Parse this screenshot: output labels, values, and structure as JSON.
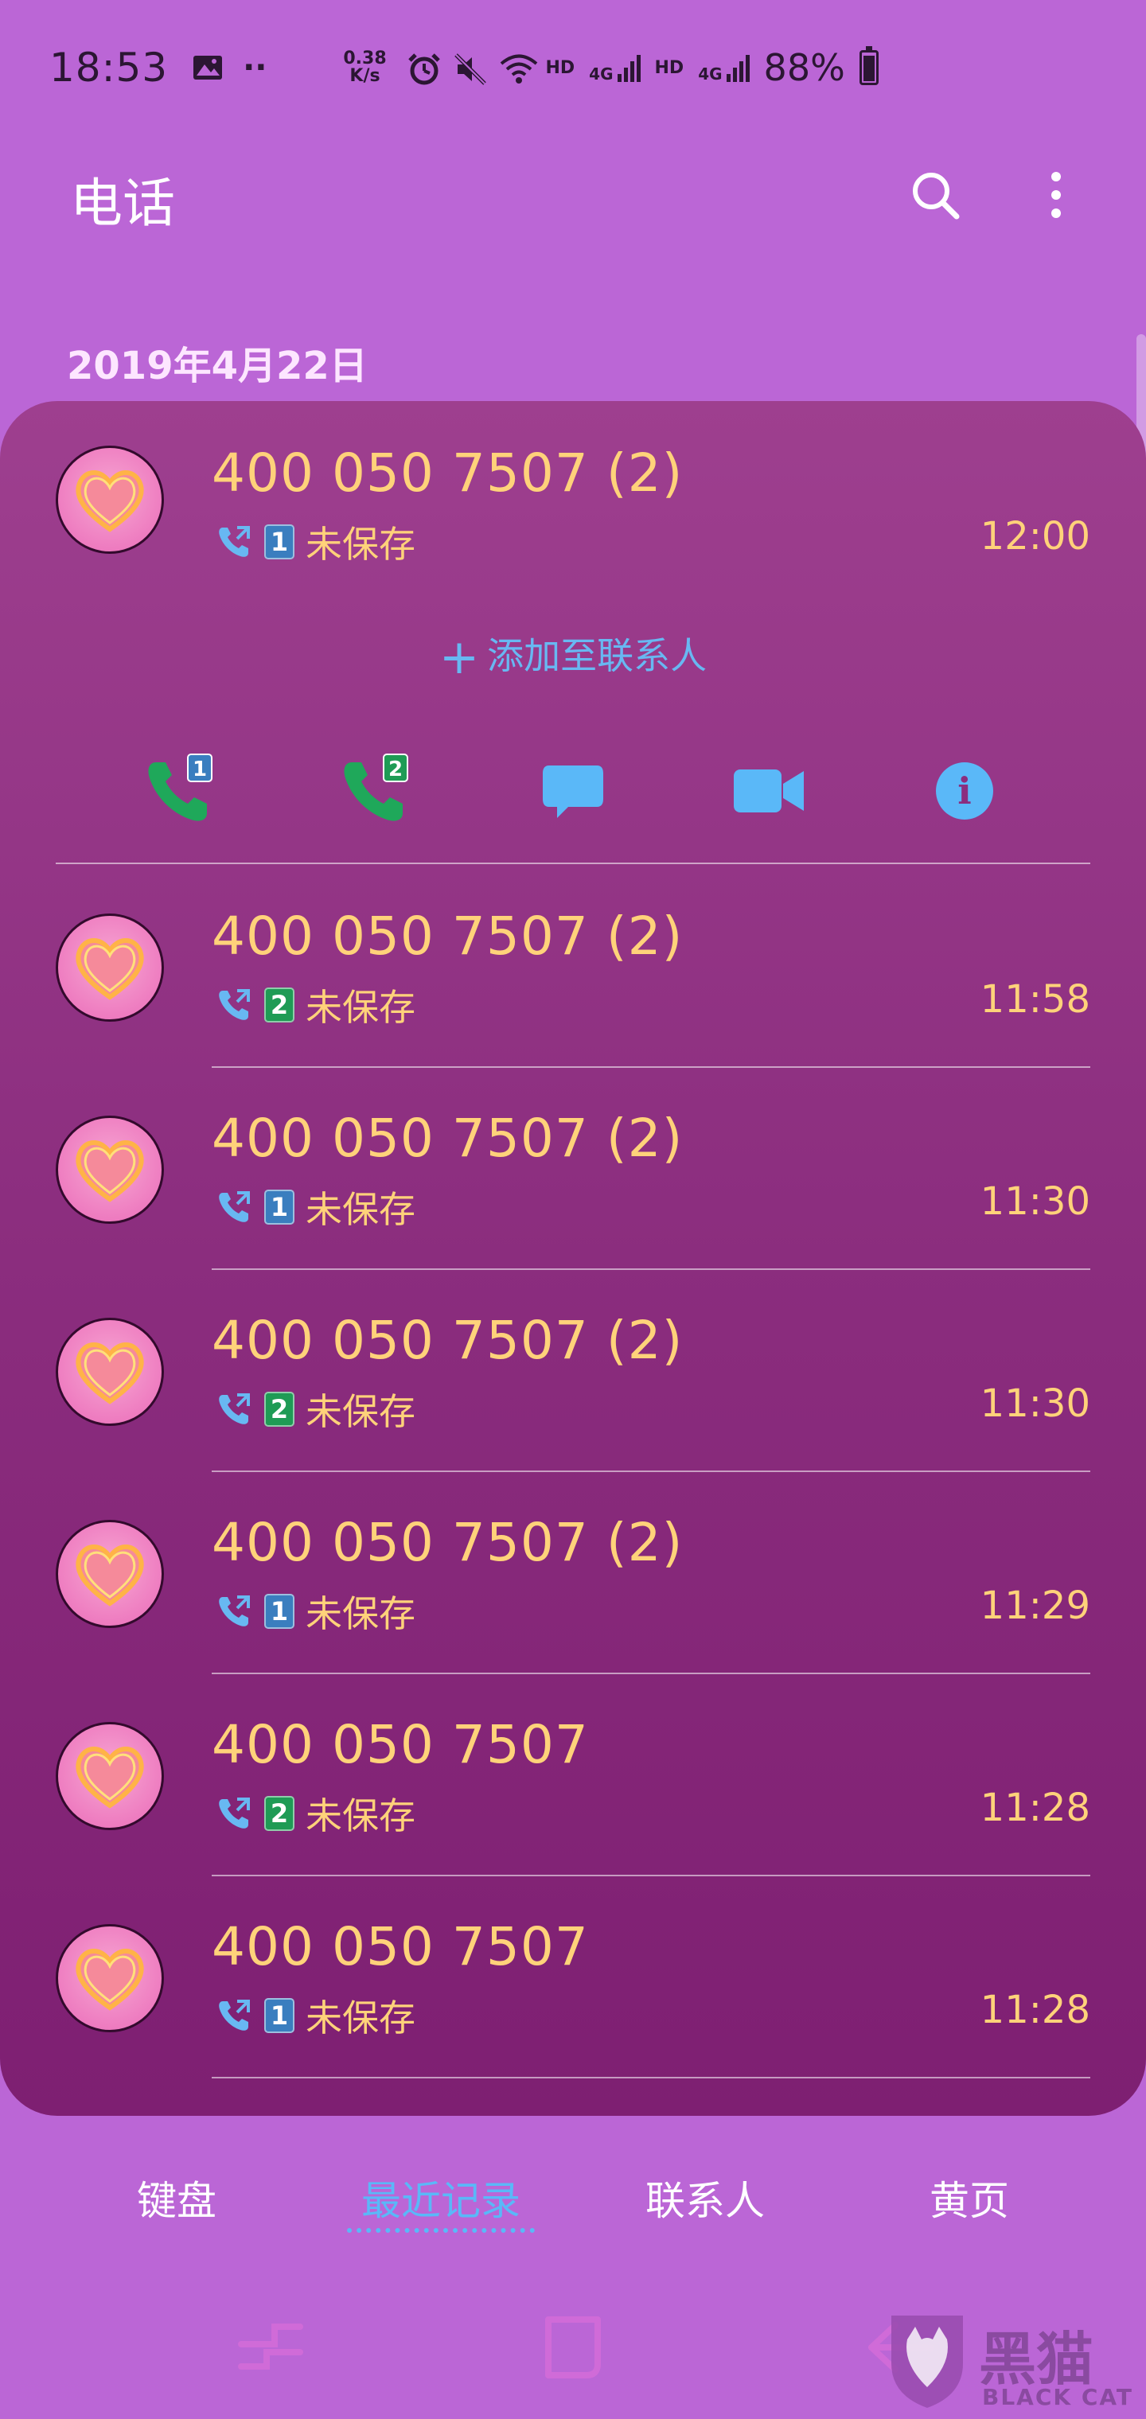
{
  "status_bar": {
    "time": "18:53",
    "dots": "··",
    "net_speed_value": "0.38",
    "net_speed_unit": "K/s",
    "hd1": "HD",
    "net1": "4G",
    "hd2": "HD",
    "net2": "4G",
    "battery": "88%"
  },
  "app_bar": {
    "title": "电话"
  },
  "date_header": "2019年4月22日",
  "calls": [
    {
      "number": "400 050 7507 (2)",
      "sim": "1",
      "status": "未保存",
      "time": "12:00"
    },
    {
      "number": "400 050 7507 (2)",
      "sim": "2",
      "status": "未保存",
      "time": "11:58"
    },
    {
      "number": "400 050 7507 (2)",
      "sim": "1",
      "status": "未保存",
      "time": "11:30"
    },
    {
      "number": "400 050 7507 (2)",
      "sim": "2",
      "status": "未保存",
      "time": "11:30"
    },
    {
      "number": "400 050 7507 (2)",
      "sim": "1",
      "status": "未保存",
      "time": "11:29"
    },
    {
      "number": "400 050 7507",
      "sim": "2",
      "status": "未保存",
      "time": "11:28"
    },
    {
      "number": "400 050 7507",
      "sim": "1",
      "status": "未保存",
      "time": "11:28"
    }
  ],
  "expanded": {
    "add_contact_label": "添加至联系人",
    "add_plus": "+",
    "call_sim1_badge": "1",
    "call_sim2_badge": "2",
    "info_glyph": "i"
  },
  "tabs": [
    {
      "label": "键盘"
    },
    {
      "label": "最近记录"
    },
    {
      "label": "联系人"
    },
    {
      "label": "黄页"
    }
  ],
  "watermark": {
    "text": "黑猫",
    "sub": "BLACK CAT"
  },
  "colors": {
    "background": "#bb66d6",
    "card_top": "#9e3f8f",
    "card_bottom": "#7e1f72",
    "number_text": "#ffd27a",
    "accent_blue": "#5ab8f8",
    "call_green": "#1fa85a"
  }
}
